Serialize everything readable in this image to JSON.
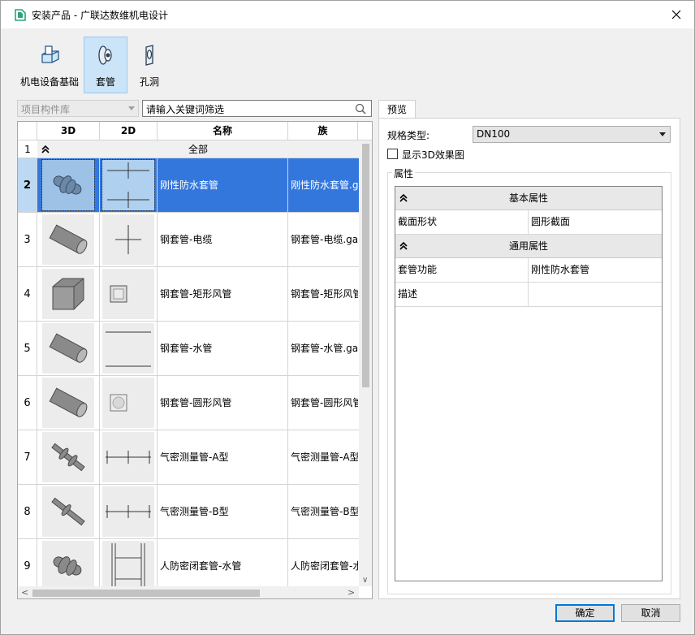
{
  "window": {
    "title": "安装产品 - 广联达数维机电设计",
    "accent": "#0078d7",
    "selection": "#3377dd"
  },
  "toolbar": {
    "items": [
      {
        "label": "机电设备基础",
        "icon": "equipment-base-icon",
        "active": false
      },
      {
        "label": "套管",
        "icon": "sleeve-icon",
        "active": true
      },
      {
        "label": "孔洞",
        "icon": "hole-icon",
        "active": false
      }
    ]
  },
  "library": {
    "selected": "项目构件库",
    "search_placeholder": "请输入关键词筛选"
  },
  "grid": {
    "columns": [
      "3D",
      "2D",
      "名称",
      "族"
    ],
    "group": {
      "num": "1",
      "label": "全部"
    },
    "rows": [
      {
        "num": "2",
        "name": "刚性防水套管",
        "file": "刚性防水套管.gac",
        "selected": true
      },
      {
        "num": "3",
        "name": "钢套管-电缆",
        "file": "钢套管-电缆.gac"
      },
      {
        "num": "4",
        "name": "钢套管-矩形风管",
        "file": "钢套管-矩形风管"
      },
      {
        "num": "5",
        "name": "钢套管-水管",
        "file": "钢套管-水管.gac"
      },
      {
        "num": "6",
        "name": "钢套管-圆形风管",
        "file": "钢套管-圆形风管"
      },
      {
        "num": "7",
        "name": "气密测量管-A型",
        "file": "气密测量管-A型"
      },
      {
        "num": "8",
        "name": "气密测量管-B型",
        "file": "气密测量管-B型"
      },
      {
        "num": "9",
        "name": "人防密闭套管-水管",
        "file": "人防密闭套管-水"
      }
    ]
  },
  "preview": {
    "tab": "预览",
    "spec_label": "规格类型:",
    "spec_value": "DN100",
    "show3d_label": "显示3D效果图",
    "properties_title": "属性",
    "sections": [
      {
        "title": "基本属性",
        "rows": [
          {
            "k": "截面形状",
            "v": "圆形截面"
          }
        ]
      },
      {
        "title": "通用属性",
        "rows": [
          {
            "k": "套管功能",
            "v": "刚性防水套管"
          },
          {
            "k": "描述",
            "v": ""
          }
        ]
      }
    ]
  },
  "buttons": {
    "ok": "确定",
    "cancel": "取消"
  }
}
